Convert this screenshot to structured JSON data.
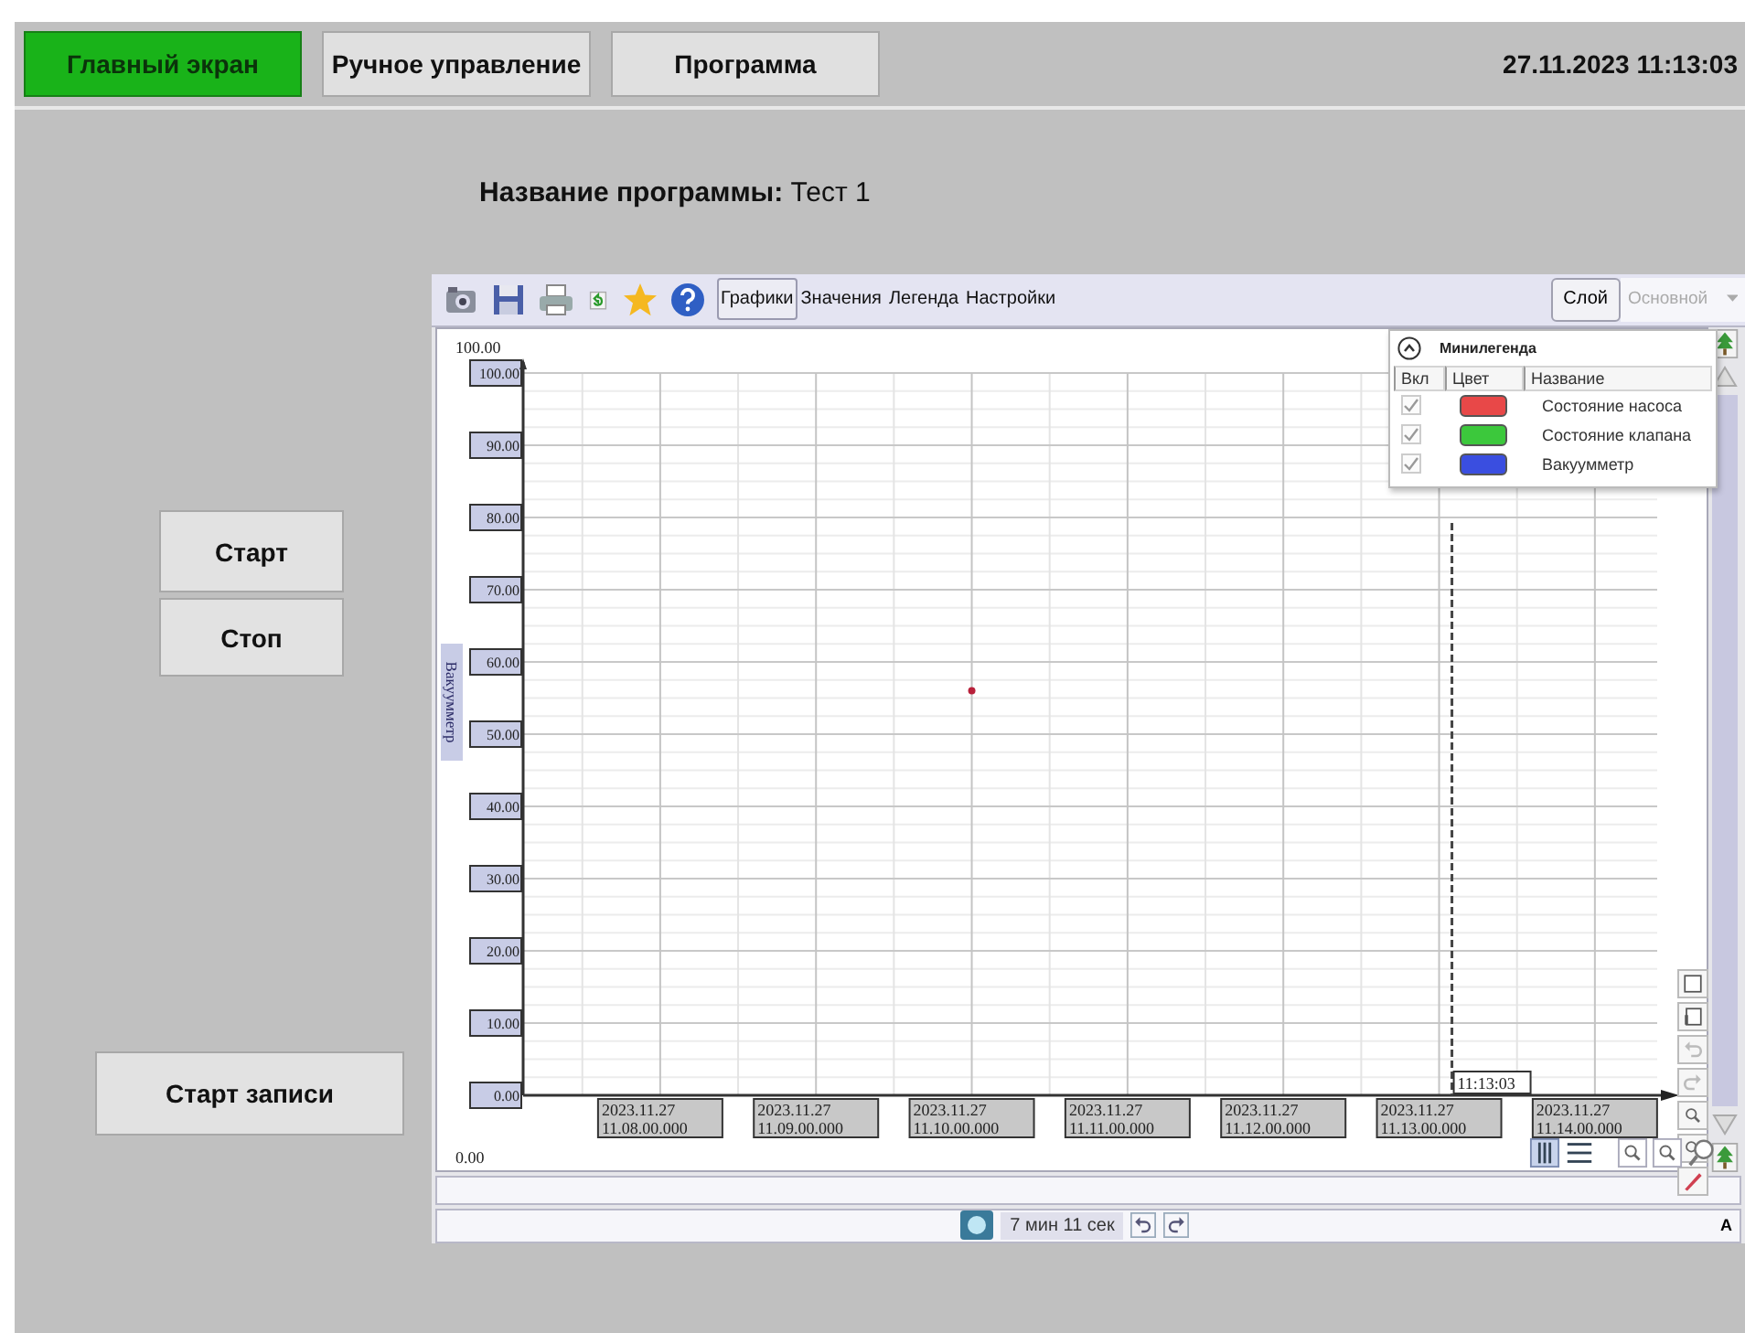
{
  "nav": [
    {
      "label": "Главный экран",
      "selected": true
    },
    {
      "label": "Ручное управление",
      "selected": false
    },
    {
      "label": "Программа",
      "selected": false
    }
  ],
  "datetime": "27.11.2023 11:13:03",
  "program": {
    "label": "Название программы:",
    "value": "Тест 1"
  },
  "controls": {
    "start": "Старт",
    "stop": "Стоп",
    "record": "Старт записи"
  },
  "chart": {
    "tabs": [
      {
        "label": "Графики",
        "selected": true
      },
      {
        "label": "Значения",
        "selected": false
      },
      {
        "label": "Легенда",
        "selected": false
      },
      {
        "label": "Настройки",
        "selected": false
      }
    ],
    "layer_button": "Слой",
    "layer": {
      "value": "Основной",
      "disabled": true
    },
    "top_value": "100.00",
    "bottom_value": "0.00",
    "chart_data": {
      "type": "scatter",
      "ylabel": "Вакуумметр",
      "series": [
        {
          "color": "#b8203a",
          "values": [
            null,
            null,
            56,
            null,
            null,
            null,
            null
          ]
        }
      ],
      "ylim": [
        0,
        100
      ],
      "grid": true,
      "categories": [
        "2023.11.27\n11.08.00.000",
        "2023.11.27\n11.09.00.000",
        "2023.11.27\n11.10.00.000",
        "2023.11.27\n11.11.00.000",
        "2023.11.27\n11.12.00.000",
        "2023.11.27\n11.13.00.000",
        "2023.11.27\n11.14.00.000"
      ],
      "yticks": [
        {
          "value": 0,
          "label": "0.00"
        },
        {
          "value": 10,
          "label": "10.00"
        },
        {
          "value": 20,
          "label": "20.00"
        },
        {
          "value": 30,
          "label": "30.00"
        },
        {
          "value": 40,
          "label": "40.00"
        },
        {
          "value": 50,
          "label": "50.00"
        },
        {
          "value": 60,
          "label": "60.00"
        },
        {
          "value": 70,
          "label": "70.00"
        },
        {
          "value": 80,
          "label": "80.00"
        },
        {
          "value": 90,
          "label": "90.00"
        },
        {
          "value": 100,
          "label": "100.00"
        }
      ],
      "stacked": false
    },
    "cursor": {
      "label": "11:13:03",
      "level": 0.819
    },
    "minilegend": {
      "title": "Минилегенда",
      "columns": [
        "Вкл",
        "Цвет",
        "Название"
      ],
      "rows": [
        {
          "checked": true,
          "color": "#e84848",
          "name": "Состояние насоса"
        },
        {
          "checked": true,
          "color": "#3cc83c",
          "name": "Состояние клапана"
        },
        {
          "checked": true,
          "color": "#3a4ee0",
          "name": "Вакуумметр"
        }
      ]
    },
    "status": {
      "duration": "7 мин 11 сек",
      "right": "A"
    }
  }
}
